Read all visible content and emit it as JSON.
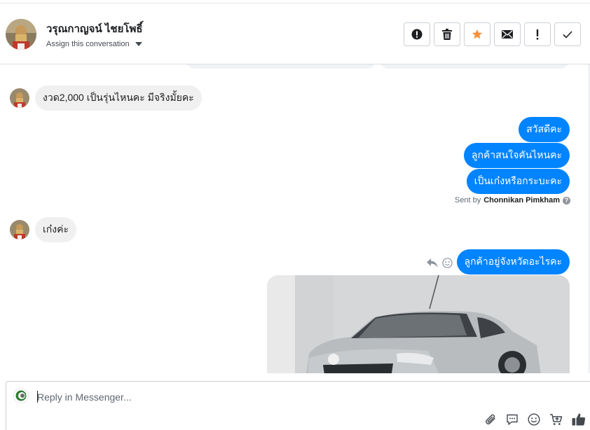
{
  "header": {
    "contact_name": "วรุณกาญจน์ ไชยโพธิ์",
    "assign_label": "Assign this conversation",
    "actions": [
      {
        "icon": "alert-circle-icon"
      },
      {
        "icon": "trash-icon"
      },
      {
        "icon": "star-icon"
      },
      {
        "icon": "envelope-icon"
      },
      {
        "icon": "exclamation-icon"
      },
      {
        "icon": "checkmark-icon"
      }
    ]
  },
  "thread": {
    "messages": [
      {
        "direction": "in",
        "text": "งวด2,000 เป็นรุ่นไหนคะ มีจริงมั้ยคะ"
      },
      {
        "direction": "out",
        "text": "สวัสดีคะ"
      },
      {
        "direction": "out",
        "text": "ลูกค้าสนใจคันไหนคะ"
      },
      {
        "direction": "out",
        "text": "เป็นเก๋งหรือกระบะคะ"
      },
      {
        "direction": "in",
        "text": "เก๋งค่ะ"
      },
      {
        "direction": "out",
        "text": "ลูกค้าอยู่จังหวัดอะไรคะ"
      }
    ],
    "sent_by_prefix": "Sent by",
    "sent_by_name": "Chonnikan Pimkham",
    "info_glyph": "?"
  },
  "composer": {
    "placeholder": "Reply in Messenger...",
    "icons": [
      "paperclip-icon",
      "saved-reply-icon",
      "emoji-icon",
      "cart-icon",
      "thumbs-up-icon"
    ]
  },
  "colors": {
    "outgoing_bubble": "#0084ff",
    "incoming_bubble": "#f1f0f0",
    "star": "#f7923b"
  }
}
